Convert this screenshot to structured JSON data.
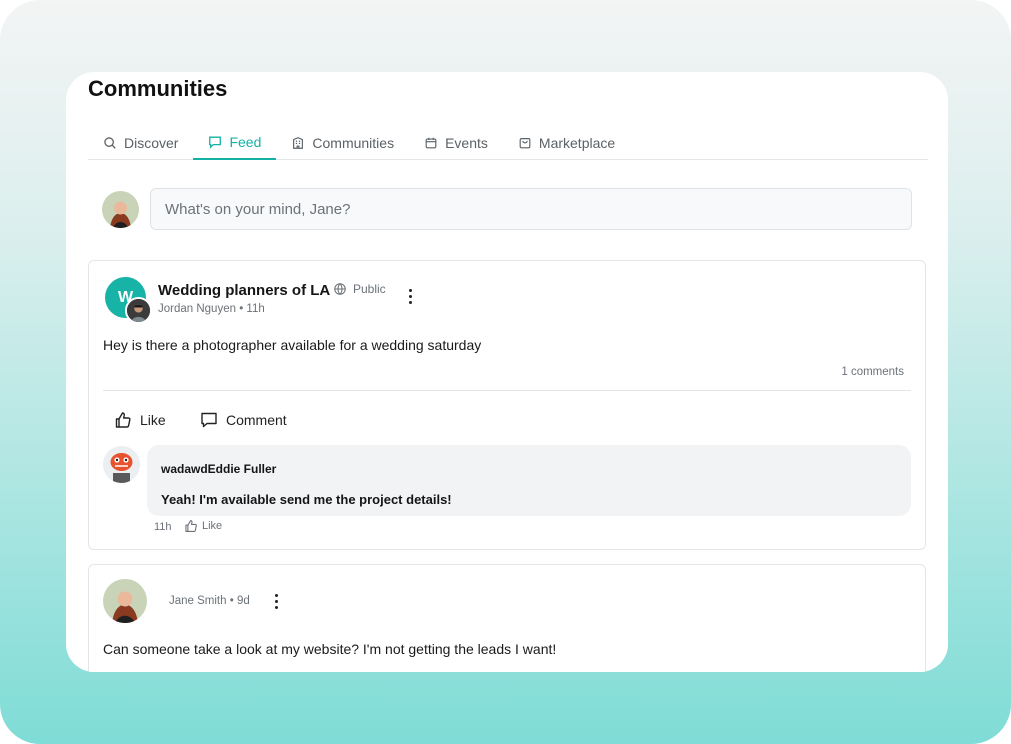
{
  "page": {
    "title": "Communities"
  },
  "tabs": [
    {
      "label": "Discover",
      "icon": "search-icon",
      "active": false
    },
    {
      "label": "Feed",
      "icon": "chat-icon",
      "active": true
    },
    {
      "label": "Communities",
      "icon": "building-icon",
      "active": false
    },
    {
      "label": "Events",
      "icon": "calendar-icon",
      "active": false
    },
    {
      "label": "Marketplace",
      "icon": "shopping-bag-icon",
      "active": false
    }
  ],
  "composer": {
    "placeholder": "What's on your mind, Jane?"
  },
  "posts": [
    {
      "group": "Wedding planners of LA",
      "group_initial": "W",
      "visibility": "Public",
      "author_time": "Jordan Nguyen • 11h",
      "text": "Hey is there a photographer available for a wedding saturday",
      "comments_count": "1 comments",
      "like_label": "Like",
      "comment_label": "Comment",
      "comment": {
        "author": "wadawdEddie Fuller",
        "text": "Yeah! I'm available send me the project details!",
        "time": "11h",
        "like_label": "Like"
      }
    },
    {
      "author_time": "Jane Smith • 9d",
      "text": "Can someone take a look at my website? I'm not getting the leads I want!"
    }
  ],
  "colors": {
    "accent": "#13b1a4",
    "group_avatar": "#17b3a6"
  }
}
